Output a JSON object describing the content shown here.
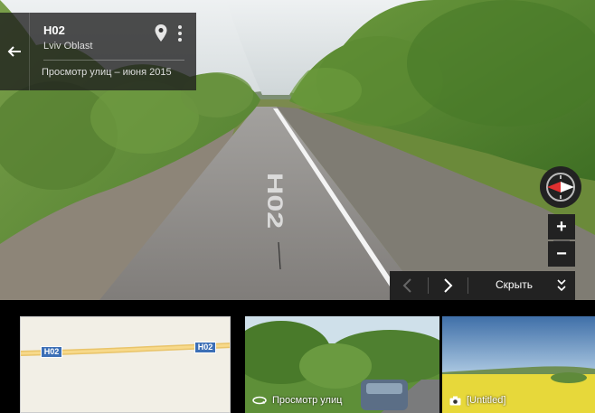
{
  "info_card": {
    "title": "H02",
    "subtitle": "Lviv Oblast",
    "date": "Просмотр улиц – июня 2015",
    "back_icon": "arrow-left-icon",
    "pin_icon": "map-pin-icon",
    "more_icon": "more-vertical-icon"
  },
  "road_marking": "H02",
  "zoom": {
    "in_label": "+",
    "out_label": "−"
  },
  "control_bar": {
    "prev_icon": "chevron-left-icon",
    "next_icon": "chevron-right-icon",
    "hide_label": "Скрыть",
    "hide_icon": "double-chevron-down-icon"
  },
  "thumbnails": {
    "map": {
      "shield_left": "H02",
      "shield_right": "H02"
    },
    "street_view": {
      "label": "Просмотр улиц",
      "icon": "street-view-rotate-icon"
    },
    "photo": {
      "label": "[Untitled]",
      "icon": "camera-icon"
    }
  },
  "colors": {
    "sky": "#d8dde0",
    "foliage": "#5f8f3a",
    "road": "#8b8987",
    "panel": "#222222",
    "shield": "#3c6fb6",
    "compass_red": "#e03030"
  }
}
